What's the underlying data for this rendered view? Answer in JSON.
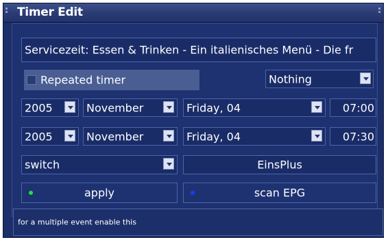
{
  "window": {
    "title": "Timer Edit"
  },
  "event_title": "Servicezeit: Essen & Trinken - Ein italienisches Menü - Die fr",
  "repeated_timer": {
    "label": "Repeated timer",
    "checked": false
  },
  "after_action": {
    "selected": "Nothing"
  },
  "start": {
    "year": "2005",
    "month": "November",
    "day": "Friday, 04",
    "time": "07:00"
  },
  "end": {
    "year": "2005",
    "month": "November",
    "day": "Friday, 04",
    "time": "07:30"
  },
  "timer_type": {
    "selected": "switch"
  },
  "channel": "EinsPlus",
  "buttons": {
    "apply": {
      "label": "apply",
      "led_color": "#22e03a"
    },
    "scan_epg": {
      "label": "scan EPG",
      "led_color": "#1a3cff"
    }
  },
  "status_text": "for a multiple event enable this",
  "icons": {
    "dropdown": "chevron-down-icon",
    "window_grip": "grip-dots-icon"
  }
}
